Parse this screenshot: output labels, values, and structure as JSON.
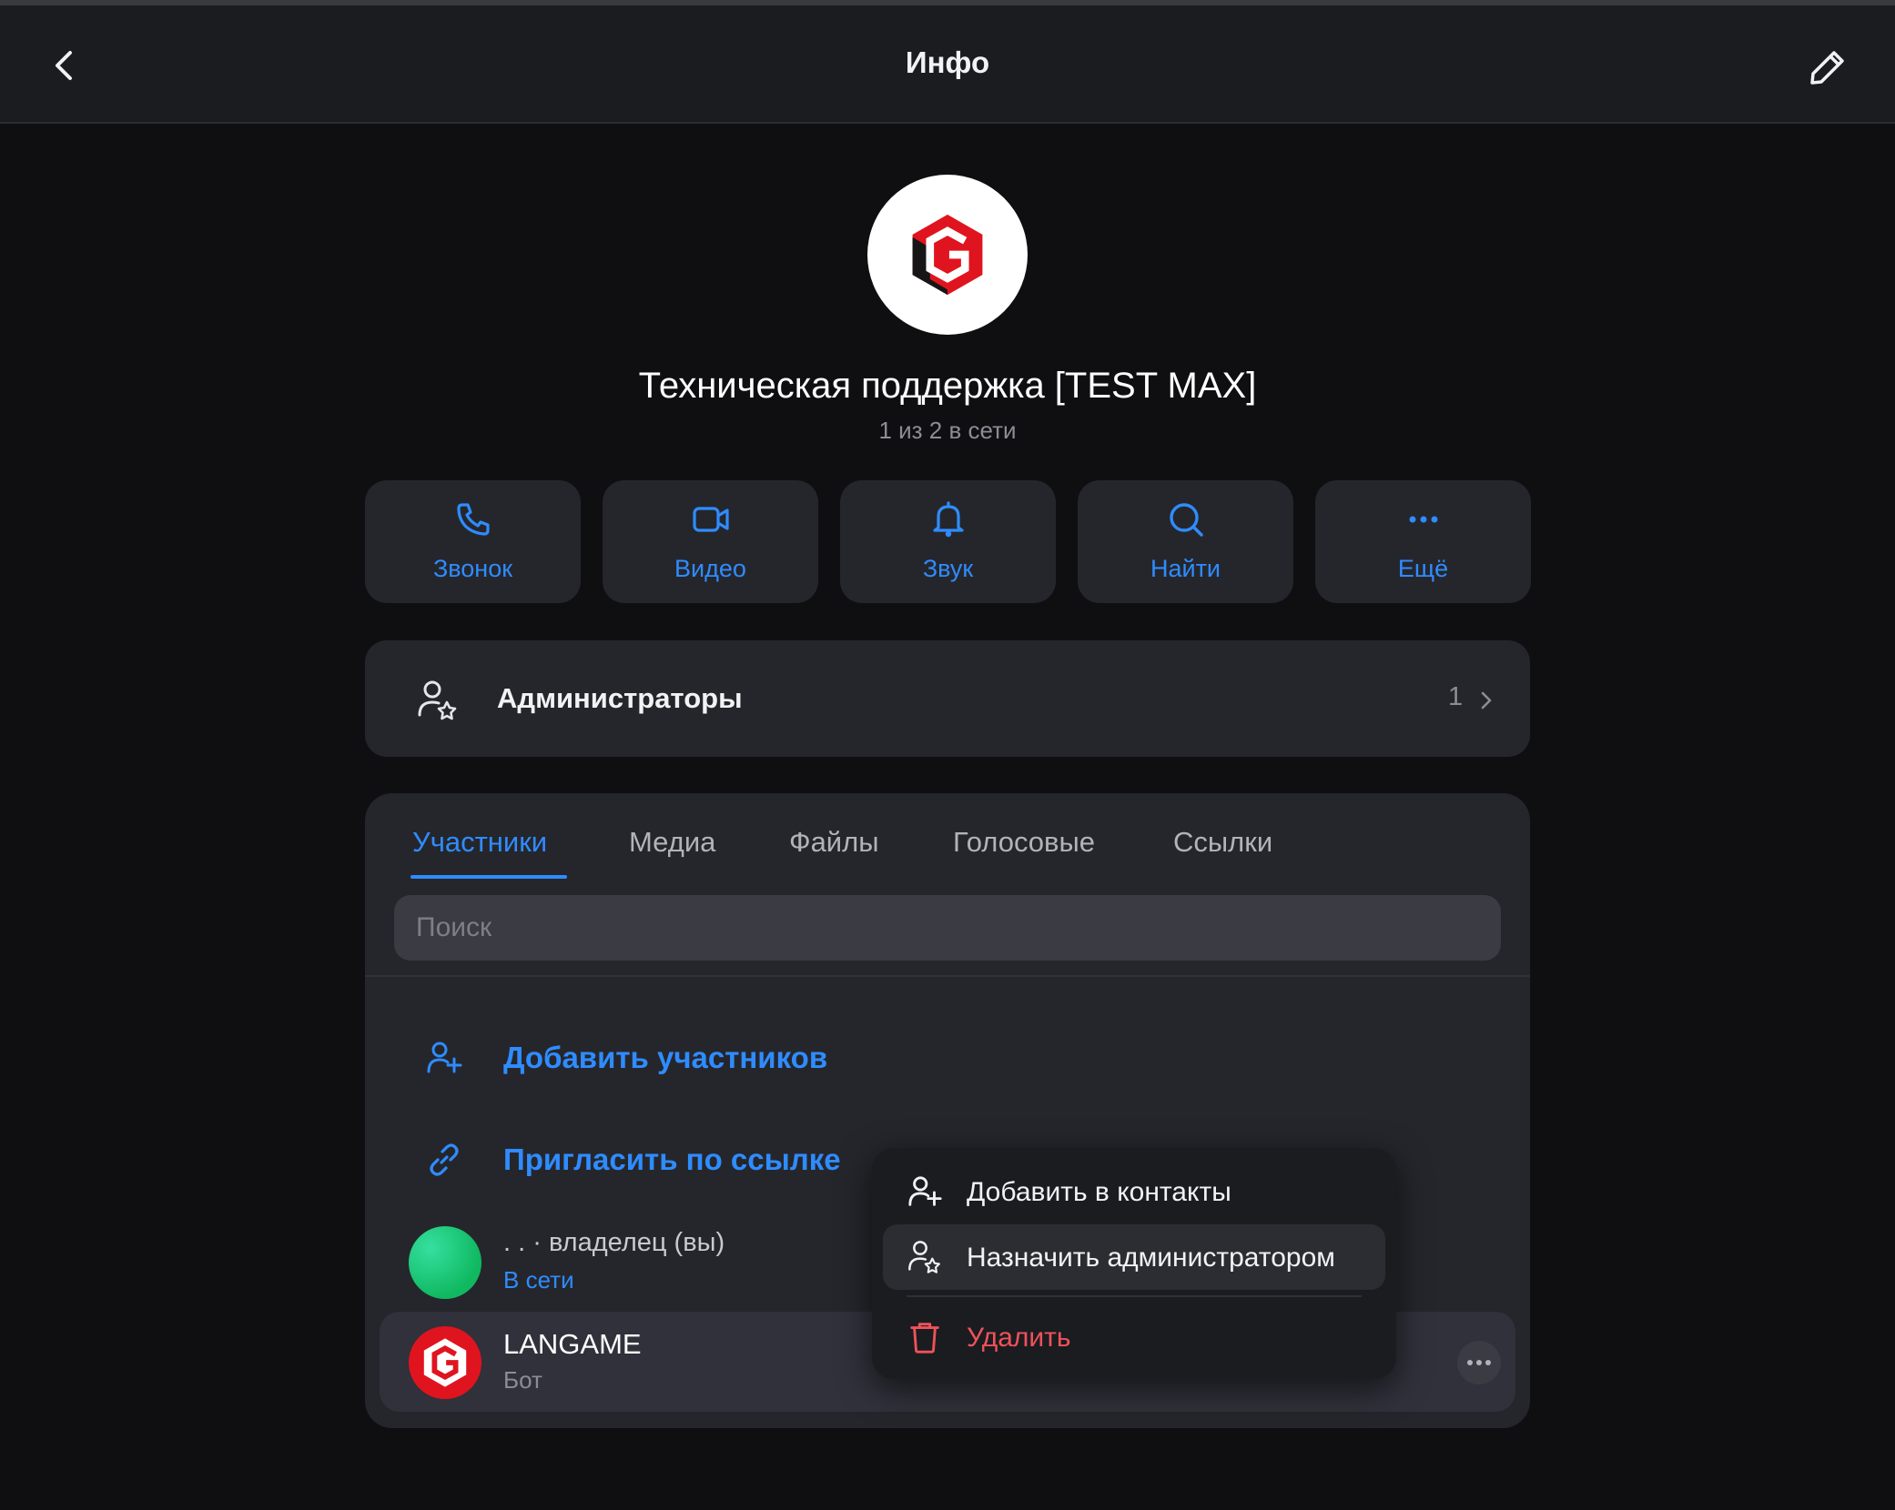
{
  "header": {
    "title": "Инфо"
  },
  "group": {
    "name": "Техническая поддержка [TEST MAX]",
    "status": "1 из 2 в сети"
  },
  "actions": [
    {
      "label": "Звонок",
      "icon": "phone-icon"
    },
    {
      "label": "Видео",
      "icon": "video-icon"
    },
    {
      "label": "Звук",
      "icon": "bell-icon"
    },
    {
      "label": "Найти",
      "icon": "search-icon"
    },
    {
      "label": "Ещё",
      "icon": "more-icon"
    }
  ],
  "admins": {
    "label": "Администраторы",
    "count": "1"
  },
  "tabs": [
    {
      "label": "Участники",
      "active": true
    },
    {
      "label": "Медиа"
    },
    {
      "label": "Файлы"
    },
    {
      "label": "Голосовые"
    },
    {
      "label": "Ссылки"
    }
  ],
  "search": {
    "placeholder": "Поиск",
    "value": ""
  },
  "links": {
    "add_members": "Добавить участников",
    "invite_link": "Пригласить по ссылке"
  },
  "members": [
    {
      "name": ". . · владелец (вы)",
      "status": "В сети"
    },
    {
      "name": "LANGAME",
      "status": "Бот"
    }
  ],
  "context_menu": {
    "items": [
      {
        "label": "Добавить в контакты"
      },
      {
        "label": "Назначить администратором"
      },
      {
        "label": "Удалить"
      }
    ]
  },
  "colors": {
    "accent": "#2f8cff",
    "danger": "#f0525a",
    "background": "#0f0f11",
    "card": "#25262c",
    "brand_red": "#e0141e"
  }
}
